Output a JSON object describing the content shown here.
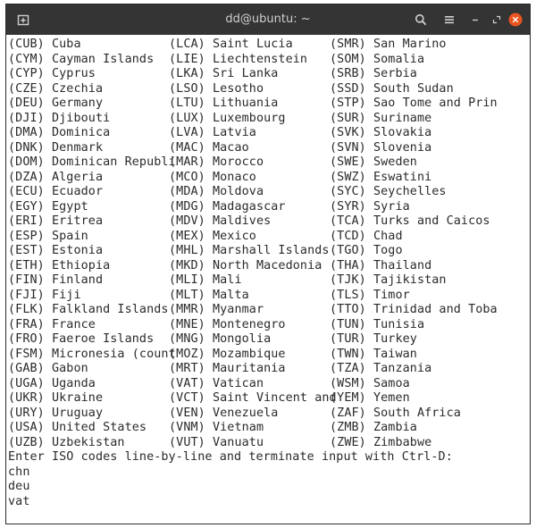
{
  "window": {
    "title": "dd@ubuntu: ~"
  },
  "titlebar_icons": {
    "new_tab": "new-tab-icon",
    "search": "search-icon",
    "menu": "hamburger-menu-icon",
    "minimize": "minimize-icon",
    "maximize": "maximize-icon",
    "close": "close-icon",
    "close_color": "#e95420"
  },
  "terminal": {
    "rows": [
      [
        "(CUB) Cuba",
        "(LCA) Saint Lucia",
        "(SMR) San Marino"
      ],
      [
        "(CYM) Cayman Islands",
        "(LIE) Liechtenstein",
        "(SOM) Somalia"
      ],
      [
        "(CYP) Cyprus",
        "(LKA) Sri Lanka",
        "(SRB) Serbia"
      ],
      [
        "(CZE) Czechia",
        "(LSO) Lesotho",
        "(SSD) South Sudan"
      ],
      [
        "(DEU) Germany",
        "(LTU) Lithuania",
        "(STP) Sao Tome and Prin"
      ],
      [
        "(DJI) Djibouti",
        "(LUX) Luxembourg",
        "(SUR) Suriname"
      ],
      [
        "(DMA) Dominica",
        "(LVA) Latvia",
        "(SVK) Slovakia"
      ],
      [
        "(DNK) Denmark",
        "(MAC) Macao",
        "(SVN) Slovenia"
      ],
      [
        "(DOM) Dominican Republi",
        "(MAR) Morocco",
        "(SWE) Sweden"
      ],
      [
        "(DZA) Algeria",
        "(MCO) Monaco",
        "(SWZ) Eswatini"
      ],
      [
        "(ECU) Ecuador",
        "(MDA) Moldova",
        "(SYC) Seychelles"
      ],
      [
        "(EGY) Egypt",
        "(MDG) Madagascar",
        "(SYR) Syria"
      ],
      [
        "(ERI) Eritrea",
        "(MDV) Maldives",
        "(TCA) Turks and Caicos"
      ],
      [
        "(ESP) Spain",
        "(MEX) Mexico",
        "(TCD) Chad"
      ],
      [
        "(EST) Estonia",
        "(MHL) Marshall Islands",
        "(TGO) Togo"
      ],
      [
        "(ETH) Ethiopia",
        "(MKD) North Macedonia",
        "(THA) Thailand"
      ],
      [
        "(FIN) Finland",
        "(MLI) Mali",
        "(TJK) Tajikistan"
      ],
      [
        "(FJI) Fiji",
        "(MLT) Malta",
        "(TLS) Timor"
      ],
      [
        "(FLK) Falkland Islands",
        "(MMR) Myanmar",
        "(TTO) Trinidad and Toba"
      ],
      [
        "(FRA) France",
        "(MNE) Montenegro",
        "(TUN) Tunisia"
      ],
      [
        "(FRO) Faeroe Islands",
        "(MNG) Mongolia",
        "(TUR) Turkey"
      ],
      [
        "(FSM) Micronesia (count",
        "(MOZ) Mozambique",
        "(TWN) Taiwan"
      ],
      [
        "(GAB) Gabon",
        "(MRT) Mauritania",
        "(TZA) Tanzania"
      ],
      [
        "(UGA) Uganda",
        "(VAT) Vatican",
        "(WSM) Samoa"
      ],
      [
        "(UKR) Ukraine",
        "(VCT) Saint Vincent and",
        "(YEM) Yemen"
      ],
      [
        "(URY) Uruguay",
        "(VEN) Venezuela",
        "(ZAF) South Africa"
      ],
      [
        "(USA) United States",
        "(VNM) Vietnam",
        "(ZMB) Zambia"
      ],
      [
        "(UZB) Uzbekistan",
        "(VUT) Vanuatu",
        "(ZWE) Zimbabwe"
      ]
    ],
    "prompt": "Enter ISO codes line-by-line and terminate input with Ctrl-D:",
    "input_lines": [
      "chn",
      "deu",
      "vat"
    ]
  }
}
